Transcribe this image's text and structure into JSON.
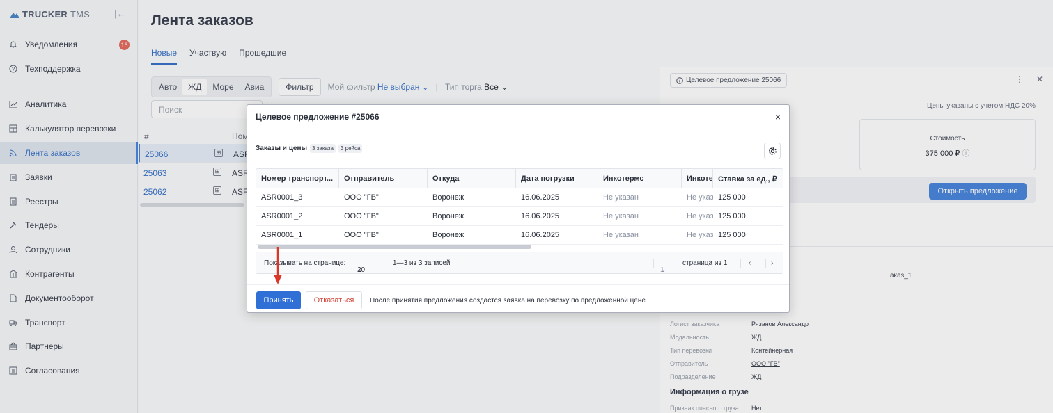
{
  "app": {
    "logo_brand": "TRUCKER",
    "logo_suffix": "TMS",
    "collapse_glyph": "|←"
  },
  "sidebar": {
    "items": [
      {
        "label": "Уведомления",
        "icon": "bell-icon",
        "glyph": "♫",
        "badge": "16"
      },
      {
        "label": "Техподдержка",
        "icon": "help-icon",
        "glyph": "?"
      },
      {
        "label": "Аналитика",
        "icon": "chart-line-icon",
        "glyph": "⟋"
      },
      {
        "label": "Калькулятор перевозки",
        "icon": "calculator-icon",
        "glyph": "▦"
      },
      {
        "label": "Лента заказов",
        "icon": "rss-feed-icon",
        "glyph": "≋",
        "active": true
      },
      {
        "label": "Заявки",
        "icon": "clipboard-icon",
        "glyph": "▤"
      },
      {
        "label": "Реестры",
        "icon": "register-icon",
        "glyph": "▣"
      },
      {
        "label": "Тендеры",
        "icon": "gavel-icon",
        "glyph": "⚒"
      },
      {
        "label": "Сотрудники",
        "icon": "user-icon",
        "glyph": "♙"
      },
      {
        "label": "Контрагенты",
        "icon": "bank-icon",
        "glyph": "⛫"
      },
      {
        "label": "Документооборот",
        "icon": "document-icon",
        "glyph": "▯"
      },
      {
        "label": "Транспорт",
        "icon": "truck-icon",
        "glyph": "⛟"
      },
      {
        "label": "Партнеры",
        "icon": "handshake-icon",
        "glyph": "⌂"
      },
      {
        "label": "Согласования",
        "icon": "approval-icon",
        "glyph": "▥"
      }
    ]
  },
  "main": {
    "title": "Лента заказов",
    "tabs": [
      {
        "label": "Новые",
        "active": true
      },
      {
        "label": "Участвую"
      },
      {
        "label": "Прошедшие"
      }
    ],
    "modes": [
      "Авто",
      "ЖД",
      "Море",
      "Авиа"
    ],
    "active_mode": "ЖД",
    "filter_label": "Фильтр",
    "my_filter_label": "Мой фильтр",
    "my_filter_value": "Не выбран",
    "trade_type_label": "Тип торга",
    "trade_type_value": "Все",
    "search_placeholder": "Поиск",
    "list_headers": {
      "hash": "#",
      "name": "Ном"
    },
    "rows": [
      {
        "id": "25066",
        "asr": "ASR"
      },
      {
        "id": "25063",
        "asr": "ASR"
      },
      {
        "id": "25062",
        "asr": "ASR"
      }
    ]
  },
  "right_panel": {
    "chip": "Целевое предложение 25066",
    "vat_note": "Цены указаны с учетом НДС 20%",
    "cost_label": "Стоимость",
    "cost_value": "375 000 ₽",
    "open_button": "Открыть предложение",
    "fragment": "аказ_1",
    "details": [
      {
        "k": "Логист заказчика",
        "v": "Рязанов Александр",
        "underline": true
      },
      {
        "k": "Модальность",
        "v": "ЖД"
      },
      {
        "k": "Тип перевозки",
        "v": "Контейнерная"
      },
      {
        "k": "Отправитель",
        "v": "ООО \"ГВ\"",
        "underline": true
      },
      {
        "k": "Подразделение",
        "v": "ЖД"
      }
    ],
    "cargo_heading": "Информация о грузе",
    "cargo_details": [
      {
        "k": "Признак опасного груза",
        "v": "Нет"
      }
    ]
  },
  "modal": {
    "title": "Целевое предложение #25066",
    "close_glyph": "×",
    "section_title": "Заказы и цены",
    "orders_chip": "3 заказа",
    "trips_chip": "3 рейса",
    "columns": [
      "Номер транспорт...",
      "Отправитель",
      "Откуда",
      "Дата погрузки",
      "Инкотермс",
      "Инкоте",
      "Ставка за ед., ₽"
    ],
    "rows": [
      [
        "ASR0001_3",
        "ООО \"ГВ\"",
        "Воронеж",
        "16.06.2025",
        "Не указан",
        "Не указан",
        "125 000"
      ],
      [
        "ASR0001_2",
        "ООО \"ГВ\"",
        "Воронеж",
        "16.06.2025",
        "Не указан",
        "Не указан",
        "125 000"
      ],
      [
        "ASR0001_1",
        "ООО \"ГВ\"",
        "Воронеж",
        "16.06.2025",
        "Не указан",
        "Не указан",
        "125 000"
      ]
    ],
    "pager": {
      "per_page_label": "Показывать на странице:",
      "per_page_value": "20",
      "range": "1—3 из 3 записей",
      "page_value": "1",
      "page_of": "страница из 1"
    },
    "accept_button": "Принять",
    "decline_button": "Отказаться",
    "footer_note": "После принятия предложения создастся заявка на перевозку по предложенной цене"
  },
  "colors": {
    "accent": "#2f6fd6",
    "annotation_arrow": "#d9372a",
    "decline_text": "#d4473a",
    "badge": "#e36d5f"
  }
}
